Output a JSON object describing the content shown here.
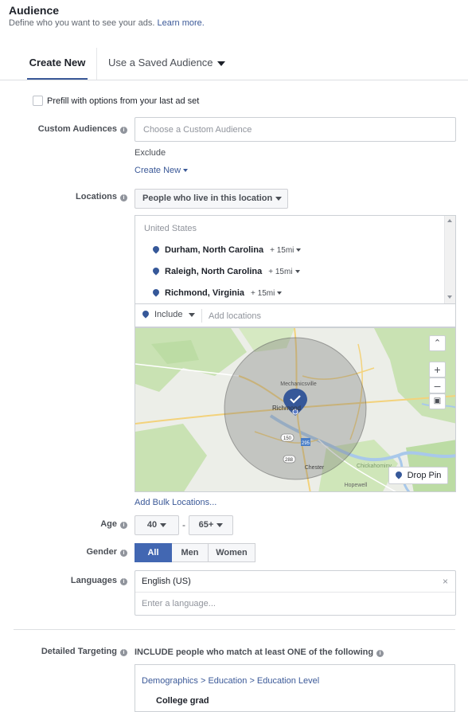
{
  "header": {
    "title": "Audience",
    "subtitle": "Define who you want to see your ads.",
    "learn_more": "Learn more."
  },
  "tabs": {
    "create_new": "Create New",
    "saved": "Use a Saved Audience"
  },
  "prefill_label": "Prefill with options from your last ad set",
  "custom_audiences": {
    "label": "Custom Audiences",
    "placeholder": "Choose a Custom Audience",
    "exclude": "Exclude",
    "create_new": "Create New"
  },
  "locations": {
    "label": "Locations",
    "mode": "People who live in this location",
    "country": "United States",
    "items": [
      {
        "name": "Durham, North Carolina",
        "radius": "+ 15mi"
      },
      {
        "name": "Raleigh, North Carolina",
        "radius": "+ 15mi"
      },
      {
        "name": "Richmond, Virginia",
        "radius": "+ 15mi"
      }
    ],
    "include": "Include",
    "add_placeholder": "Add locations",
    "bulk": "Add Bulk Locations...",
    "map": {
      "places": [
        "Mechanicsville",
        "Richmond",
        "Chester",
        "Chickahominy",
        "Hopewell"
      ],
      "route_labels": [
        "150",
        "295",
        "288"
      ],
      "drop_pin": "Drop Pin"
    }
  },
  "age": {
    "label": "Age",
    "min": "40",
    "max": "65+",
    "dash": "-"
  },
  "gender": {
    "label": "Gender",
    "options": [
      "All",
      "Men",
      "Women"
    ],
    "selected": "All"
  },
  "languages": {
    "label": "Languages",
    "selected": "English (US)",
    "placeholder": "Enter a language..."
  },
  "detailed_targeting": {
    "label": "Detailed Targeting",
    "description": "INCLUDE people who match at least ONE of the following",
    "breadcrumb": "Demographics > Education > Education Level",
    "item": "College grad"
  },
  "colors": {
    "accent": "#4267b2",
    "link": "#3b5998",
    "pin": "#365899"
  }
}
